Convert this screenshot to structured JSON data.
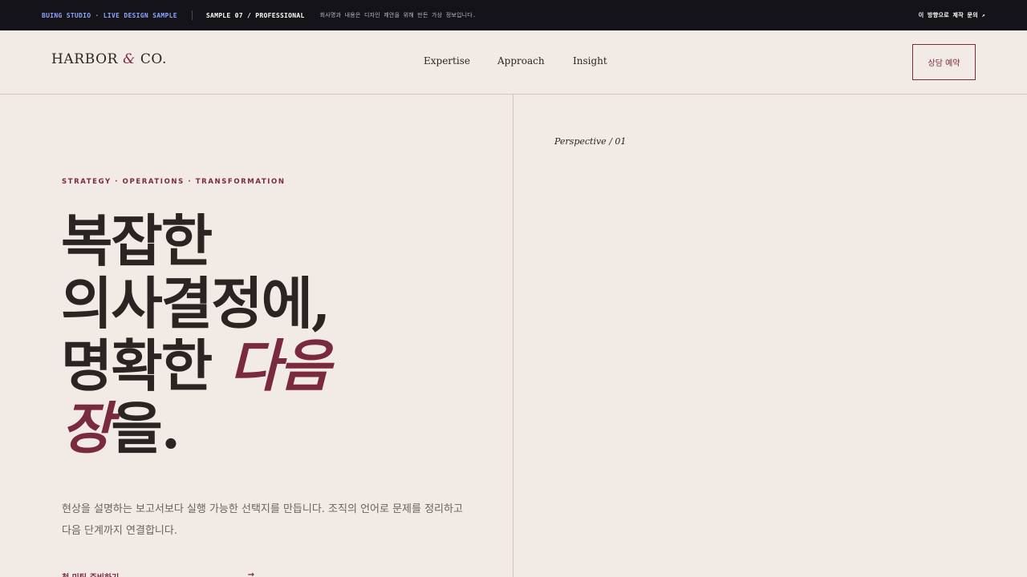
{
  "topbar": {
    "studio": "BUING STUDIO · LIVE DESIGN SAMPLE",
    "sample": "SAMPLE 07 / PROFESSIONAL",
    "note": "회사명과 내용은 디자인 제안을 위해 만든 가상 정보입니다.",
    "inquiry": "이 방향으로 제작 문의 ↗"
  },
  "header": {
    "logo_left": "HARBOR",
    "logo_amp": "&",
    "logo_right": "CO.",
    "nav": [
      "Expertise",
      "Approach",
      "Insight"
    ],
    "cta": "상담 예약"
  },
  "hero": {
    "eyebrow": "STRATEGY · OPERATIONS · TRANSFORMATION",
    "headline_1": "복잡한",
    "headline_2": "의사결정에,",
    "headline_3a": "명확한 ",
    "headline_3b": "다음",
    "headline_4a": "장",
    "headline_4b": "을.",
    "lede": "현상을 설명하는 보고서보다 실행 가능한 선택지를 만듭니다. 조직의 언어로 문제를 정리하고 다음 단계까지 연결합니다.",
    "link_label": "첫 미팅 준비하기",
    "link_arrow": "→"
  },
  "aside": {
    "perspective": "Perspective / 01"
  },
  "colors": {
    "background": "#f2ebe5",
    "accent": "#7a2a3d",
    "topbar": "#131318",
    "topbar_highlight": "#8fa6ff"
  }
}
